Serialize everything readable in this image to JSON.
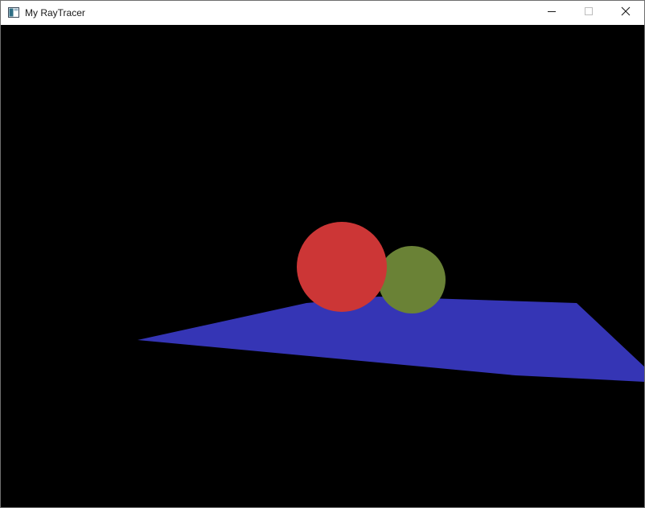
{
  "window": {
    "title": "My RayTracer"
  },
  "icons": {
    "app": "app-window-icon",
    "minimize": "minimize-icon",
    "maximize": "maximize-icon",
    "close": "close-icon"
  },
  "scene": {
    "background_color": "#000000",
    "plane_color": "#3535b5",
    "red_sphere_color": "#cc3636",
    "green_sphere_color": "#6a8236"
  }
}
